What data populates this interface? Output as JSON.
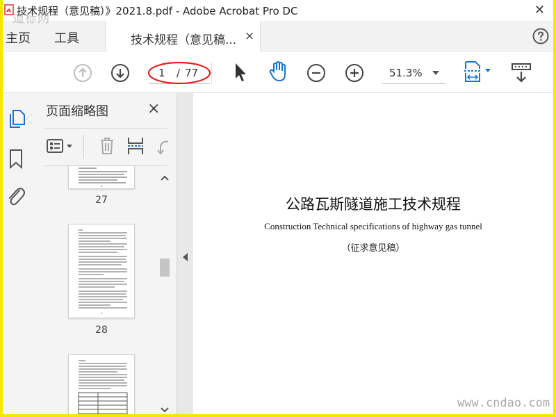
{
  "window": {
    "title": "技术规程（意见稿）》2021.8.pdf - Adobe Acrobat Pro DC"
  },
  "tabs": {
    "home": "主页",
    "tools": "工具",
    "document": "技术规程（意见稿...",
    "document_close": "×"
  },
  "toolbar": {
    "page_current": "1",
    "page_separator": "/",
    "page_total": "77",
    "zoom": "51.3%"
  },
  "thumbnail_panel": {
    "title": "页面缩略图",
    "close": "×",
    "pages": [
      {
        "number": "27"
      },
      {
        "number": "28"
      }
    ]
  },
  "document": {
    "title_cn": "公路瓦斯隧道施工技术规程",
    "title_en": "Construction Technical specifications of highway gas tunnel",
    "status": "（征求意见稿）"
  },
  "watermarks": {
    "top_left": "道标网",
    "bottom_right": "www.cndao.com"
  },
  "colors": {
    "page_background": "#f6e600",
    "accent_blue": "#1a73c8",
    "annotation_red": "#e02020",
    "app_icon_red": "#d9261c"
  },
  "icons": {
    "app": "pdf-app-icon",
    "window_close": "close-icon",
    "help": "help-icon",
    "prev_page": "arrow-up-circle-icon",
    "next_page": "arrow-down-circle-icon",
    "select": "cursor-arrow-icon",
    "hand": "hand-icon",
    "zoom_out": "zoom-out-icon",
    "zoom_in": "zoom-in-icon",
    "fit_page": "fit-page-icon",
    "scroll_mode": "scroll-mode-icon",
    "pages_panel": "pages-panel-icon",
    "bookmarks": "bookmark-icon",
    "attachments": "paperclip-icon",
    "thumb_options": "thumbnail-options-icon",
    "delete": "trash-icon",
    "insert_page": "insert-page-icon",
    "rotate": "rotate-icon"
  }
}
